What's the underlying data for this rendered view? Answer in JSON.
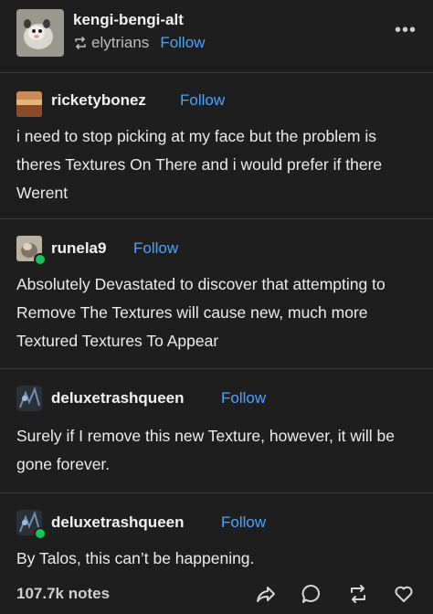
{
  "header": {
    "blog_name": "kengi-bengi-alt",
    "reblogged_from": "elytrians",
    "follow_label": "Follow",
    "more_label": "•••"
  },
  "posts": [
    {
      "name": "ricketybonez",
      "follow_label": "Follow",
      "body": "i need to stop picking at my face but the problem is theres Textures On There and i would prefer if there Werent"
    },
    {
      "name": "runela9",
      "follow_label": "Follow",
      "body": "Absolutely Devastated to discover that attempting to Remove The Textures will cause new, much more Textured Textures To Appear"
    },
    {
      "name": "deluxetrashqueen",
      "follow_label": "Follow",
      "body": "Surely if I remove this new Texture, however, it will be gone forever."
    },
    {
      "name": "deluxetrashqueen",
      "follow_label": "Follow",
      "body": "By Talos, this can’t be happening."
    }
  ],
  "footer": {
    "notes": "107.7k notes"
  },
  "colors": {
    "background": "#1e1e1e",
    "link": "#4aa3ff",
    "reblog_badge": "#19c45a"
  }
}
